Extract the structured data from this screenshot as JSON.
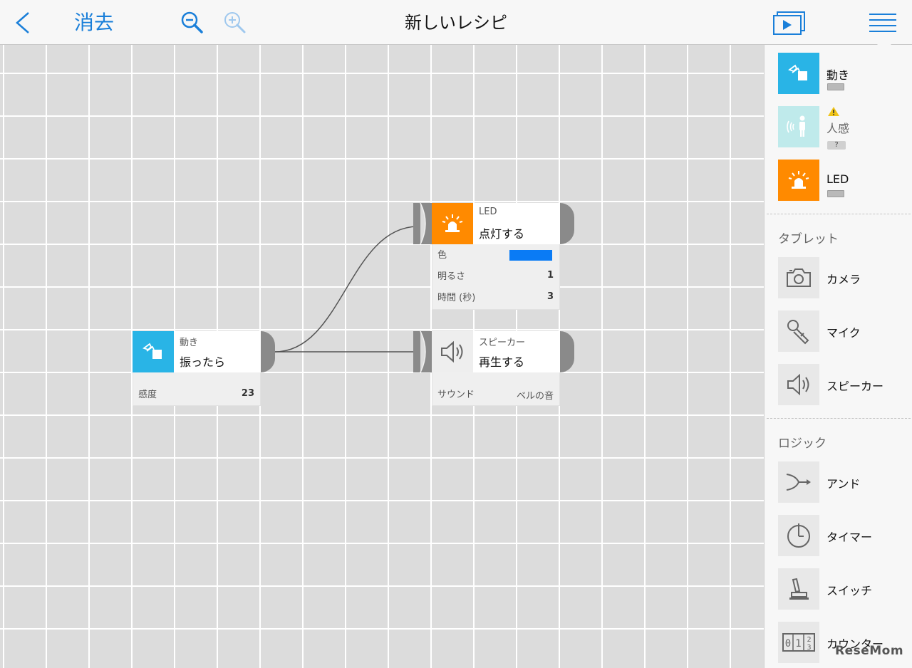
{
  "topbar": {
    "clear_label": "消去",
    "title": "新しいレシピ"
  },
  "nodes": {
    "motion": {
      "category": "動き",
      "action": "振ったら",
      "params": [
        {
          "label": "感度",
          "value": "23"
        }
      ]
    },
    "led": {
      "category": "LED",
      "action": "点灯する",
      "color_label": "色",
      "color_value": "#0a7bf5",
      "params": [
        {
          "label": "明るさ",
          "value": "1"
        },
        {
          "label": "時間 (秒)",
          "value": "3"
        }
      ]
    },
    "speaker": {
      "category": "スピーカー",
      "action": "再生する",
      "params": [
        {
          "label": "サウンド",
          "value": "ベルの音"
        }
      ]
    }
  },
  "panel": {
    "devices": [
      {
        "label": "動き",
        "color": "#29b4e6"
      },
      {
        "label": "人感",
        "color": "#bfeaeb",
        "status": "?"
      },
      {
        "label": "LED",
        "color": "#ff8a00"
      }
    ],
    "tablet_title": "タブレット",
    "tablet_items": [
      {
        "label": "カメラ",
        "icon": "camera-icon"
      },
      {
        "label": "マイク",
        "icon": "microphone-icon"
      },
      {
        "label": "スピーカー",
        "icon": "speaker-icon"
      }
    ],
    "logic_title": "ロジック",
    "logic_items": [
      {
        "label": "アンド",
        "icon": "and-merge-icon"
      },
      {
        "label": "タイマー",
        "icon": "timer-icon"
      },
      {
        "label": "スイッチ",
        "icon": "switch-icon"
      },
      {
        "label": "カウンター",
        "icon": "counter-icon"
      }
    ]
  },
  "watermark": "ReseMom",
  "colors": {
    "accent": "#1a7fd9",
    "motion": "#29b4e6",
    "led": "#ff8a00"
  }
}
